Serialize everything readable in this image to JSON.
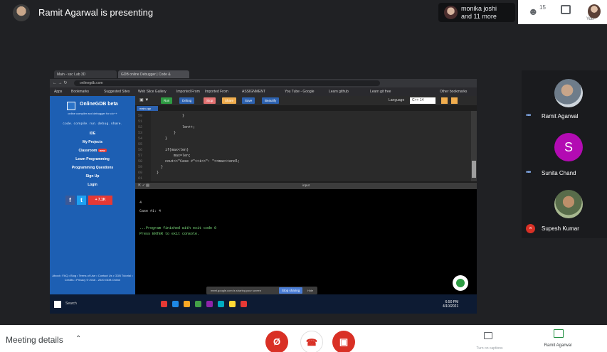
{
  "meeting": {
    "presenting_label": "Ramit Agarwal is presenting",
    "participants_chip": {
      "name": "monika joshi",
      "more": "and 11 more"
    },
    "people_count": "15",
    "you_label": "You"
  },
  "shared_screen": {
    "browser": {
      "tabs": [
        "Main - ssc Lab 3D",
        "GDB online Debugger | Code &"
      ],
      "url": "onlinegdb.com",
      "bookmarks": [
        "Apps",
        "Bookmarks",
        "Suggested Sites",
        "Web Slice Gallery",
        "Imported From",
        "Imported From",
        "ASSIGNMENT",
        "You Tube - Google",
        "Learn github",
        "Learn git free",
        "Other bookmarks"
      ]
    },
    "site": {
      "name": "OnlineGDB beta",
      "tagline": "online compiler and debugger for c/c++",
      "motto": "code. compile. run. debug. share.",
      "links": [
        "IDE",
        "My Projects",
        "Classroom",
        "Learn Programming",
        "Programming Questions",
        "Sign Up",
        "Login"
      ],
      "classroom_badge": "new",
      "social": [
        {
          "icon": "facebook-icon",
          "label": "f",
          "color": "#3b5998"
        },
        {
          "icon": "twitter-icon",
          "label": "t",
          "color": "#1da1f2"
        },
        {
          "icon": "share-icon",
          "label": "+ 7.1K",
          "color": "#e53935"
        }
      ],
      "footer": "About • FAQ • Blog • Terms of Use • Contact Us • GDB Tutorial • Credits • Privacy © 2016 - 2020 GDB Online"
    },
    "ide": {
      "toolbar": [
        {
          "label": "Run",
          "color": "#2e9b43"
        },
        {
          "label": "Debug",
          "color": "#2d62b0"
        },
        {
          "label": "Stop",
          "color": "#e57373"
        },
        {
          "label": "Share",
          "color": "#f0ad4e"
        },
        {
          "label": "Save",
          "color": "#2d62b0"
        },
        {
          "label": "Beautify",
          "color": "#2d62b0"
        }
      ],
      "language_label": "Language",
      "language": "C++ 14",
      "file_tab": "main.cpp",
      "line_numbers": [
        "50",
        "51",
        "52",
        "53",
        "54",
        "55",
        "56",
        "57",
        "58",
        "59",
        "60",
        "61"
      ],
      "code_lines": [
        "            }",
        "",
        "            len++;",
        "        }",
        "    }",
        "",
        "    if(max<len)",
        "        max=len;",
        "    cout<<\"Case #\"<<i<<\": \"<<max<<endl;",
        "  }",
        "}"
      ],
      "console_title": "input",
      "console_lines": [
        {
          "text": "4",
          "color": "#d4d4d4"
        },
        {
          "text": "Case #1: 4",
          "color": "#d4d4d4"
        },
        {
          "text": "",
          "color": "#d4d4d4"
        },
        {
          "text": "...Program finished with exit code 0",
          "color": "#7ee07e"
        },
        {
          "text": "Press ENTER to exit console.",
          "color": "#7ee07e"
        }
      ],
      "sharing_banner": "meet.google.com is sharing your screen",
      "stop_sharing": "Stop sharing",
      "hide": "Hide"
    },
    "taskbar": {
      "search": "Search",
      "icons": [
        "#e53935",
        "#1e88e5",
        "#f9a825",
        "#43a047",
        "#8e24aa",
        "#00acc1",
        "#fdd835",
        "#e53935"
      ],
      "time": "6:50 PM",
      "date": "4/10/2021"
    }
  },
  "participants": [
    {
      "name": "Ramit Agarwal",
      "avatar": "photo"
    },
    {
      "name": "Sunita Chand",
      "avatar": "S",
      "color": "#b30bb3"
    },
    {
      "name": "Supesh Kumar",
      "avatar": "photo",
      "muted": true
    }
  ],
  "controls": {
    "meeting_details": "Meeting details",
    "captions_label": "Turn on captions",
    "presenting_label": "Ramit Agarwal"
  },
  "colors": {
    "stage": "#202124",
    "mic_off": "#d93025",
    "presenting": "#1e8e3e"
  }
}
